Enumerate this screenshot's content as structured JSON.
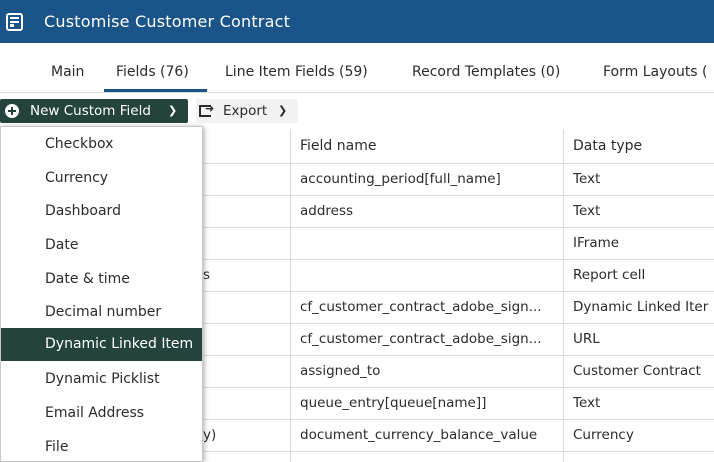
{
  "window": {
    "title": "Customise Customer Contract",
    "icon": "form-icon"
  },
  "tabs": [
    {
      "label": "Main"
    },
    {
      "label": "Fields (76)",
      "active": true
    },
    {
      "label": "Line Item Fields (59)"
    },
    {
      "label": "Record Templates (0)"
    },
    {
      "label": "Form Layouts ("
    }
  ],
  "toolbar": {
    "new_field_label": "New Custom Field",
    "new_field_icon": "plus-circle-icon",
    "export_label": "Export",
    "export_icon": "export-icon"
  },
  "table": {
    "columns": [
      "Field name",
      "Data type"
    ],
    "rows": [
      {
        "first": "",
        "field_name": "accounting_period[full_name]",
        "data_type": "Text"
      },
      {
        "first": "",
        "field_name": "address",
        "data_type": "Text"
      },
      {
        "first": "",
        "field_name": "",
        "data_type": "IFrame"
      },
      {
        "first": "s",
        "field_name": "",
        "data_type": "Report cell"
      },
      {
        "first": "",
        "field_name": "cf_customer_contract_adobe_sign...",
        "data_type": "Dynamic Linked Iter"
      },
      {
        "first": "",
        "field_name": "cf_customer_contract_adobe_sign...",
        "data_type": "URL"
      },
      {
        "first": "",
        "field_name": "assigned_to",
        "data_type": "Customer Contract"
      },
      {
        "first": "",
        "field_name": "queue_entry[queue[name]]",
        "data_type": "Text"
      },
      {
        "first": "y)",
        "field_name": "document_currency_balance_value",
        "data_type": "Currency"
      }
    ]
  },
  "menu": {
    "highlighted": "Dynamic Linked Item",
    "items": [
      "Checkbox",
      "Currency",
      "Dashboard",
      "Date",
      "Date & time",
      "Decimal number",
      "Dynamic Linked Item",
      "Dynamic Picklist",
      "Email Address",
      "File"
    ]
  },
  "colors": {
    "header": "#1a5488",
    "button": "#24433c"
  }
}
